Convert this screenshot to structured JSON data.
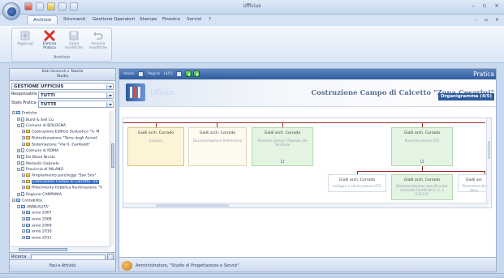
{
  "window": {
    "title": "Ufficius",
    "controls": {
      "minimize": "–",
      "maximize": "▫",
      "close": "×"
    }
  },
  "ribbon": {
    "tabs": [
      {
        "label": "Archivio",
        "active": true
      },
      {
        "label": "Strumenti"
      },
      {
        "label": "Gestione Operatori"
      },
      {
        "label": "Stampe"
      },
      {
        "label": "Finestra"
      },
      {
        "label": "Servizi"
      },
      {
        "label": "?"
      }
    ],
    "controls": {
      "minimize": "–",
      "restore": "▫",
      "close": "×"
    },
    "group_name": "Archivio",
    "buttons": [
      {
        "label": "Aggiungi",
        "icon": "add-icon",
        "enabled": false
      },
      {
        "label": "Elimina Pratica",
        "icon": "delete-icon",
        "enabled": true
      },
      {
        "label": "Salva modifiche",
        "icon": "save-icon",
        "enabled": false
      },
      {
        "label": "Annulla modifiche",
        "icon": "undo-icon",
        "enabled": false
      }
    ]
  },
  "left_pane": {
    "header": "Dati Generali e Tabelle\nStudio",
    "section_dropdown": "GESTIONE UFFICIUS",
    "responsabile": {
      "label": "Responsabile",
      "value": "TUTTI"
    },
    "stato": {
      "label": "Stato Pratica",
      "value": "TUTTE"
    },
    "tree": [
      {
        "label": "Pratiche",
        "depth": 0,
        "exp": "−",
        "icon": "chart"
      },
      {
        "label": "Build & Sell Co.",
        "depth": 1,
        "exp": "+",
        "icon": "doc"
      },
      {
        "label": "Comune di BOLOGNA",
        "depth": 1,
        "exp": "−",
        "icon": "doc"
      },
      {
        "label": "Costruzione Edificio Scolastico \"A. M",
        "depth": 2,
        "exp": "+",
        "icon": "folder"
      },
      {
        "label": "Ristrutturazione \"Torre degli Asinell",
        "depth": 2,
        "exp": "+",
        "icon": "folder"
      },
      {
        "label": "Sistemazione \"Via G. Garibaldi\"",
        "depth": 2,
        "exp": "+",
        "icon": "folder"
      },
      {
        "label": "Comune di ROMA",
        "depth": 1,
        "exp": "+",
        "icon": "doc"
      },
      {
        "label": "De Biase Nicola",
        "depth": 1,
        "exp": "+",
        "icon": "doc"
      },
      {
        "label": "Melandri Gabriele",
        "depth": 1,
        "exp": "+",
        "icon": "doc"
      },
      {
        "label": "Provincia di MILANO",
        "depth": 1,
        "exp": "−",
        "icon": "doc"
      },
      {
        "label": "Ampliamento parcheggi \"San Siro\"",
        "depth": 2,
        "exp": "+",
        "icon": "folder"
      },
      {
        "label": "Costruzione Campo di Calcetto \"Zo",
        "depth": 2,
        "exp": "+",
        "icon": "folder",
        "selected": true
      },
      {
        "label": "Rifacimento Pubblica Illuminazione \"V",
        "depth": 2,
        "exp": "+",
        "icon": "folder"
      },
      {
        "label": "Regione CAMPANIA",
        "depth": 1,
        "exp": "+",
        "icon": "doc"
      },
      {
        "label": "Contabilità",
        "depth": 0,
        "exp": "−",
        "icon": "chart"
      },
      {
        "label": "ANNUALITA'",
        "depth": 1,
        "exp": "−",
        "icon": "chart"
      },
      {
        "label": "anno  2007",
        "depth": 2,
        "exp": "+",
        "icon": "chart"
      },
      {
        "label": "anno  2008",
        "depth": 2,
        "exp": "+",
        "icon": "chart"
      },
      {
        "label": "anno  2009",
        "depth": 2,
        "exp": "+",
        "icon": "chart"
      },
      {
        "label": "anno  2010",
        "depth": 2,
        "exp": "+",
        "icon": "chart"
      },
      {
        "label": "anno  2011",
        "depth": 2,
        "exp": "+",
        "icon": "chart"
      }
    ],
    "search_label": "Ricerca",
    "footer": "Fasi e Attività"
  },
  "main_pane": {
    "toolbar": {
      "azioni": "Azioni",
      "pagina": "Pagina",
      "page_counter": "(4/5)",
      "section_title": "Pratica"
    },
    "banner_ghost": "Ufficius",
    "project_name": "Costruzione Campo di Calcetto \"Zona Cesarini\"",
    "organigramma": "Organigramma (4/5)",
    "cards": [
      {
        "name": "Gialli arch. Corrado",
        "role": "Incarico",
        "style": "beige"
      },
      {
        "name": "Gialli arch. Corrado",
        "role": "Documentazione Preliminare",
        "style": "cream"
      },
      {
        "name": "Gialli arch. Corrado",
        "role": "Ricerche presso l'Agenzia del Territorio",
        "style": "green"
      },
      {
        "name": "Gialli arch. Corrado",
        "role": "Ricerche presso UTC",
        "style": "green"
      },
      {
        "name": "Gialli arch. Corrado",
        "role": "Indagini e visure presso UTC",
        "style": "white"
      },
      {
        "name": "Gialli arch. Corrado",
        "role": "Documentazione specifica per richiesta Certificati C.U. e E.O.U.P.",
        "style": "green"
      },
      {
        "name": "Gialli arc",
        "role": "Presentazi dei docu",
        "style": "white"
      }
    ],
    "status_text": "Amministratore, \"Studio di Progettazione e Servizi\""
  }
}
